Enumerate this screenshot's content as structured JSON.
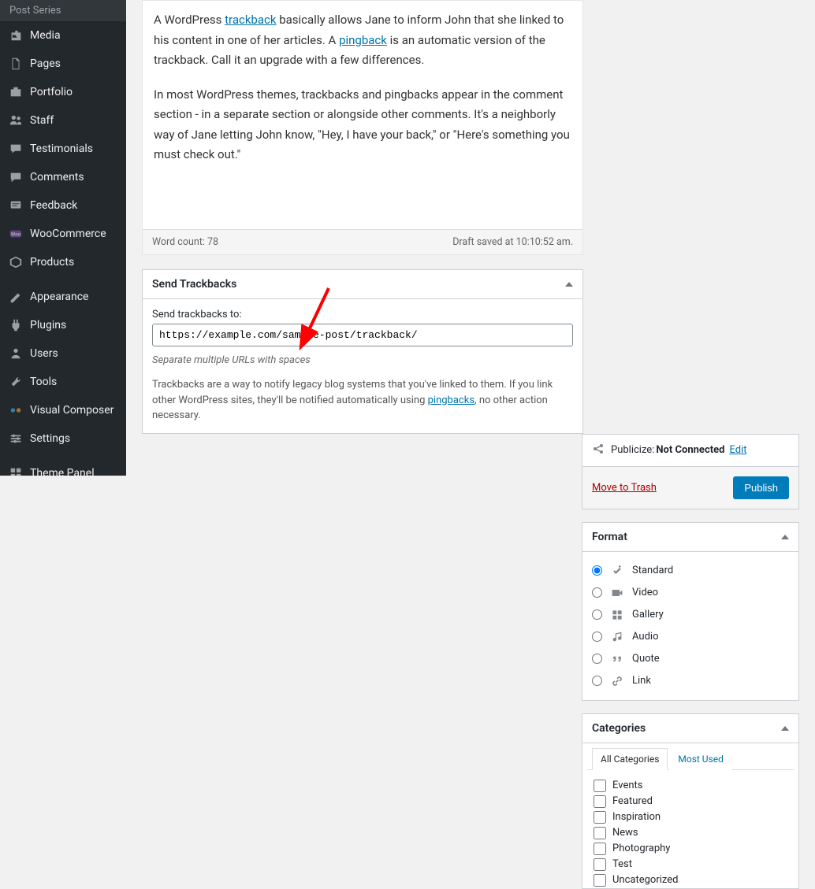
{
  "sidebar": {
    "sub_item": "Post Series",
    "items": [
      {
        "icon": "media",
        "label": "Media"
      },
      {
        "icon": "page",
        "label": "Pages"
      },
      {
        "icon": "portfolio",
        "label": "Portfolio"
      },
      {
        "icon": "staff",
        "label": "Staff"
      },
      {
        "icon": "testimonials",
        "label": "Testimonials"
      },
      {
        "icon": "comments",
        "label": "Comments"
      },
      {
        "icon": "feedback",
        "label": "Feedback"
      },
      {
        "icon": "woo",
        "label": "WooCommerce"
      },
      {
        "icon": "products",
        "label": "Products"
      }
    ],
    "items2": [
      {
        "icon": "appearance",
        "label": "Appearance"
      },
      {
        "icon": "plugins",
        "label": "Plugins"
      },
      {
        "icon": "users",
        "label": "Users"
      },
      {
        "icon": "tools",
        "label": "Tools"
      },
      {
        "icon": "vc",
        "label": "Visual Composer"
      },
      {
        "icon": "settings",
        "label": "Settings"
      }
    ],
    "items3": [
      {
        "icon": "theme",
        "label": "Theme Panel"
      }
    ]
  },
  "editor": {
    "p1a": "A WordPress ",
    "p1link1": "trackback",
    "p1b": " basically allows Jane to inform John that she linked to his content in one of her articles. A ",
    "p1link2": "pingback",
    "p1c": " is an automatic version of the trackback. Call it an upgrade with a few differences.",
    "p2": "In most WordPress themes, trackbacks and pingbacks appear in the comment section - in a separate section or alongside other comments. It's a neighborly way of Jane letting John know, \"Hey, I have your back,\" or \"Here's something you must check out.\"",
    "word_count_label": "Word count: ",
    "word_count": "78",
    "draft_saved": "Draft saved at 10:10:52 am."
  },
  "trackback_box": {
    "title": "Send Trackbacks",
    "label": "Send trackbacks to:",
    "value": "https://example.com/sample-post/trackback/",
    "hint": "Separate multiple URLs with spaces",
    "desc1": "Trackbacks are a way to notify legacy blog systems that you've linked to them. If you link other WordPress sites, they'll be notified automatically using ",
    "desc_link": "pingbacks",
    "desc2": ", no other action necessary."
  },
  "publish": {
    "publicize_label": "Publicize: ",
    "publicize_status": "Not Connected",
    "edit": "Edit",
    "trash": "Move to Trash",
    "button": "Publish"
  },
  "format": {
    "title": "Format",
    "options": [
      "Standard",
      "Video",
      "Gallery",
      "Audio",
      "Quote",
      "Link"
    ],
    "selected": 0
  },
  "categories": {
    "title": "Categories",
    "tabs": [
      "All Categories",
      "Most Used"
    ],
    "items": [
      "Events",
      "Featured",
      "Inspiration",
      "News",
      "Photography",
      "Test",
      "Uncategorized"
    ]
  }
}
